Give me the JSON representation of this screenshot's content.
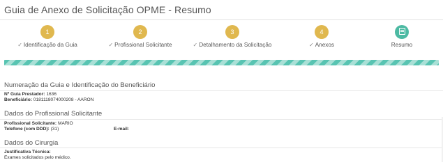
{
  "page": {
    "title": "Guia de Anexo de Solicitação OPME - Resumo"
  },
  "wizard": {
    "steps": [
      {
        "number": "1",
        "label": "Identificação da Guia",
        "status": "done"
      },
      {
        "number": "2",
        "label": "Profissional Solicitante",
        "status": "done"
      },
      {
        "number": "3",
        "label": "Detalhamento da Solicitação",
        "status": "done"
      },
      {
        "number": "4",
        "label": "Anexos",
        "status": "done"
      },
      {
        "number": "",
        "label": "Resumo",
        "status": "active"
      }
    ],
    "progress_fraction": 1.0
  },
  "sections": {
    "beneficiario": {
      "title": "Numeração da Guia e Identificação do Beneficiário",
      "guia_label": "Nº Guia Prestador:",
      "guia_value": "1636",
      "benef_label": "Beneficiário:",
      "benef_value": "0181118074000208 - AARON"
    },
    "profissional": {
      "title": "Dados do Profissional Solicitante",
      "prof_label": "Profissional Solicitante:",
      "prof_value": "MARIO",
      "tel_label": "Telefone (com DDD):",
      "tel_value": "(31)",
      "email_label": "E-mail:",
      "email_value": ""
    },
    "cirurgia": {
      "title": "Dados do Cirurgia",
      "just_label": "Justificativa Técnica:",
      "just_value": "Exames solicitados pelo médico."
    }
  },
  "colors": {
    "done_step": "#e0b84f",
    "active_step": "#4dbaa3",
    "progress": "#58c4b2"
  },
  "icons": {
    "completed": "check-icon",
    "resumo": "document-icon"
  }
}
